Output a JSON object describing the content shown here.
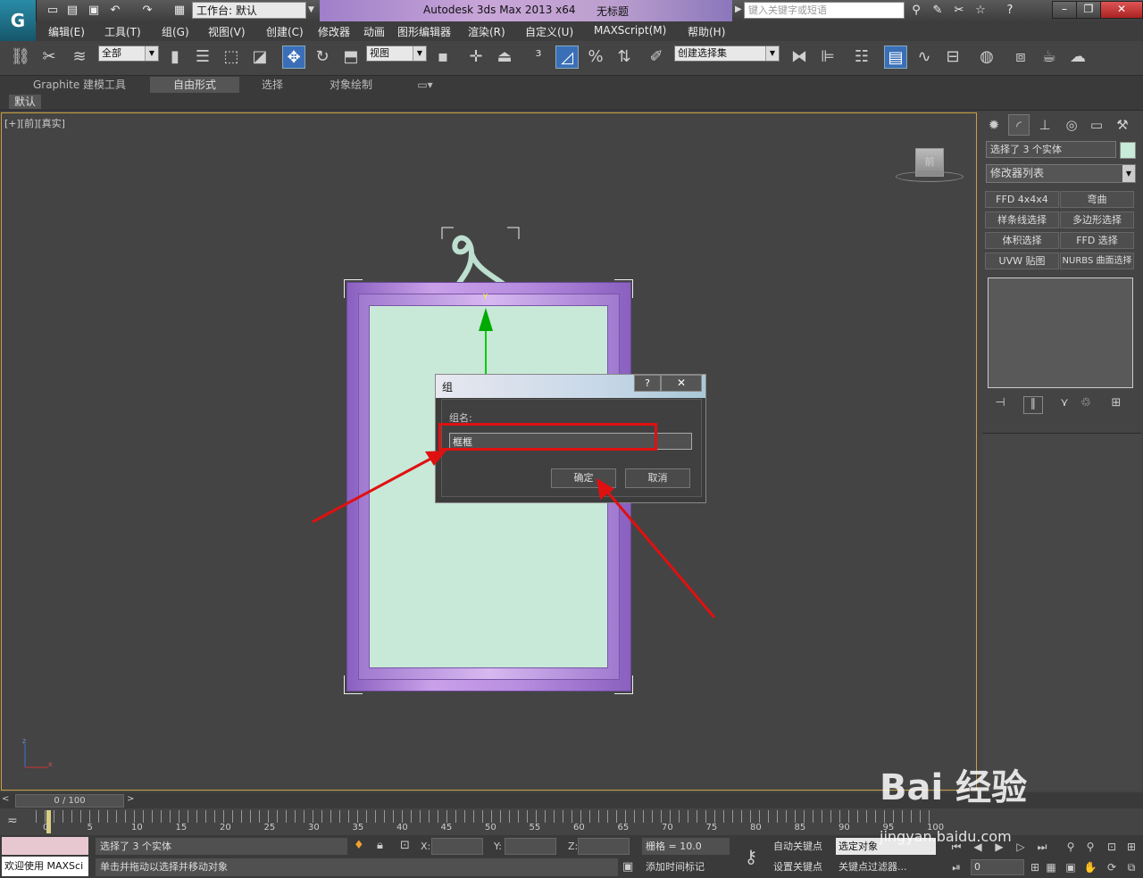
{
  "titlebar": {
    "workspace": "工作台: 默认",
    "app_title": "Autodesk 3ds Max  2013 x64",
    "doc_title": "无标题",
    "search_placeholder": "键入关键字或短语"
  },
  "menu": [
    "编辑(E)",
    "工具(T)",
    "组(G)",
    "视图(V)",
    "创建(C)",
    "修改器",
    "动画",
    "图形编辑器",
    "渲染(R)",
    "自定义(U)",
    "MAXScript(M)",
    "帮助(H)"
  ],
  "toolbar": {
    "filter": "全部",
    "ref_coord": "视图",
    "named_sel": "创建选择集"
  },
  "ribbon": {
    "tabs": [
      "Graphite 建模工具",
      "自由形式",
      "选择",
      "对象绘制"
    ],
    "sub": "默认"
  },
  "viewport": {
    "label": "[+][前][真实]",
    "viewcube": "前",
    "gizmo_axis": "Y"
  },
  "dialog": {
    "title": "组",
    "help": "?",
    "close": "✕",
    "label": "组名:",
    "value": "框框",
    "ok": "确定",
    "cancel": "取消"
  },
  "command_panel": {
    "selection": "选择了 3 个实体",
    "modifier_list": "修改器列表",
    "color": "#c8ead8",
    "modifiers": [
      "FFD 4x4x4",
      "弯曲",
      "样条线选择",
      "多边形选择",
      "体积选择",
      "FFD 选择",
      "UVW 贴图",
      "NURBS 曲面选择"
    ]
  },
  "timeline": {
    "slider": "0 / 100",
    "ticks": [
      "0",
      "5",
      "10",
      "15",
      "20",
      "25",
      "30",
      "35",
      "40",
      "45",
      "50",
      "55",
      "60",
      "65",
      "70",
      "75",
      "80",
      "85",
      "90",
      "95",
      "100"
    ]
  },
  "status": {
    "welcome": "欢迎使用 MAXSci",
    "selected": "选择了 3 个实体",
    "hint": "单击并拖动以选择并移动对象",
    "x_label": "X:",
    "y_label": "Y:",
    "z_label": "Z:",
    "grid": "栅格 = 10.0",
    "add_time_tag": "添加时间标记",
    "auto_key": "自动关键点",
    "set_key": "设置关键点",
    "selected_set": "选定对象",
    "key_filters": "关键点过滤器...",
    "frame": "0"
  },
  "watermark": {
    "logo": "Bai 经验",
    "url": "jingyan.baidu.com"
  }
}
